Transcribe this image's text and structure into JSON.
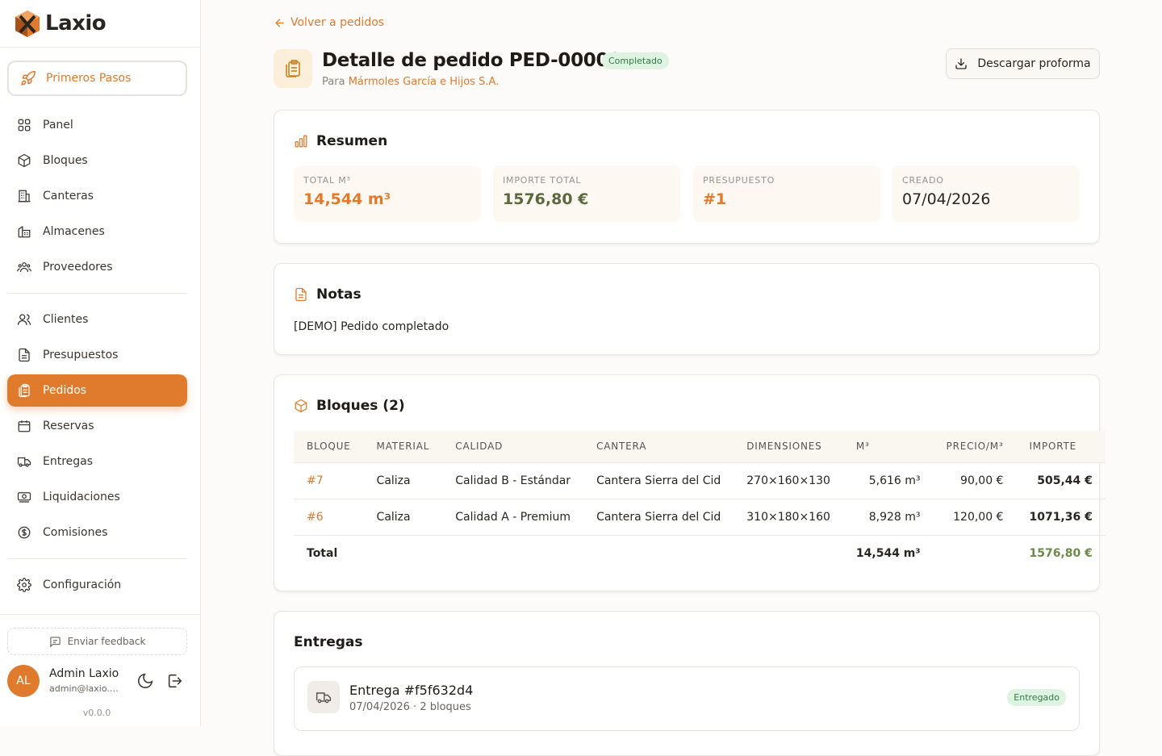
{
  "app": {
    "name": "Laxio",
    "version": "v0.0.0"
  },
  "sidebar": {
    "primeros": "Primeros Pasos",
    "group1": [
      {
        "label": "Panel",
        "icon": "grid-icon"
      },
      {
        "label": "Bloques",
        "icon": "box-icon"
      },
      {
        "label": "Canteras",
        "icon": "building-icon"
      },
      {
        "label": "Almacenes",
        "icon": "warehouse-icon"
      },
      {
        "label": "Proveedores",
        "icon": "users-icon"
      }
    ],
    "group2": [
      {
        "label": "Clientes",
        "icon": "user-icon"
      },
      {
        "label": "Presupuestos",
        "icon": "document-icon"
      },
      {
        "label": "Pedidos",
        "icon": "clipboard-icon"
      },
      {
        "label": "Reservas",
        "icon": "calendar-icon"
      },
      {
        "label": "Entregas",
        "icon": "truck-icon"
      },
      {
        "label": "Liquidaciones",
        "icon": "banknote-icon"
      },
      {
        "label": "Comisiones",
        "icon": "dollar-icon"
      }
    ],
    "group3": [
      {
        "label": "Configuración",
        "icon": "gear-icon"
      }
    ],
    "feedback": "Enviar feedback",
    "user": {
      "initials": "AL",
      "name": "Admin Laxio",
      "email": "admin@laxio.a..."
    }
  },
  "page": {
    "back": "Volver a pedidos",
    "title": "Detalle de pedido PED-000001",
    "status": "Completado",
    "subtitle_prefix": "Para",
    "client": "Mármoles García e Hijos S.A.",
    "download": "Descargar proforma"
  },
  "resumen": {
    "title": "Resumen",
    "stats": [
      {
        "label": "TOTAL M³",
        "value": "14,544 m³",
        "color": "#e07a2c"
      },
      {
        "label": "IMPORTE TOTAL",
        "value": "1576,80 €",
        "color": "#5a6a3e"
      },
      {
        "label": "PRESUPUESTO",
        "value": "#1",
        "color": "#e07a2c"
      },
      {
        "label": "CREADO",
        "value": "07/04/2026",
        "color": "#2a2520"
      }
    ]
  },
  "notas": {
    "title": "Notas",
    "text": "[DEMO] Pedido completado"
  },
  "bloques": {
    "title": "Bloques (2)",
    "headers": [
      "BLOQUE",
      "MATERIAL",
      "CALIDAD",
      "CANTERA",
      "DIMENSIONES",
      "M³",
      "PRECIO/M³",
      "IMPORTE"
    ],
    "rows": [
      [
        "#7",
        "Caliza",
        "Calidad B - Estándar",
        "Cantera Sierra del Cid",
        "270×160×130",
        "5,616 m³",
        "90,00 €",
        "505,44 €"
      ],
      [
        "#6",
        "Caliza",
        "Calidad A - Premium",
        "Cantera Sierra del Cid",
        "310×180×160",
        "8,928 m³",
        "120,00 €",
        "1071,36 €"
      ]
    ],
    "total": {
      "label": "Total",
      "m3": "14,544 m³",
      "importe": "1576,80 €"
    }
  },
  "entregas": {
    "title": "Entregas",
    "items": [
      {
        "title": "Entrega #f5f632d4",
        "sub": "07/04/2026 · 2 bloques",
        "status": "Entregado"
      }
    ]
  }
}
